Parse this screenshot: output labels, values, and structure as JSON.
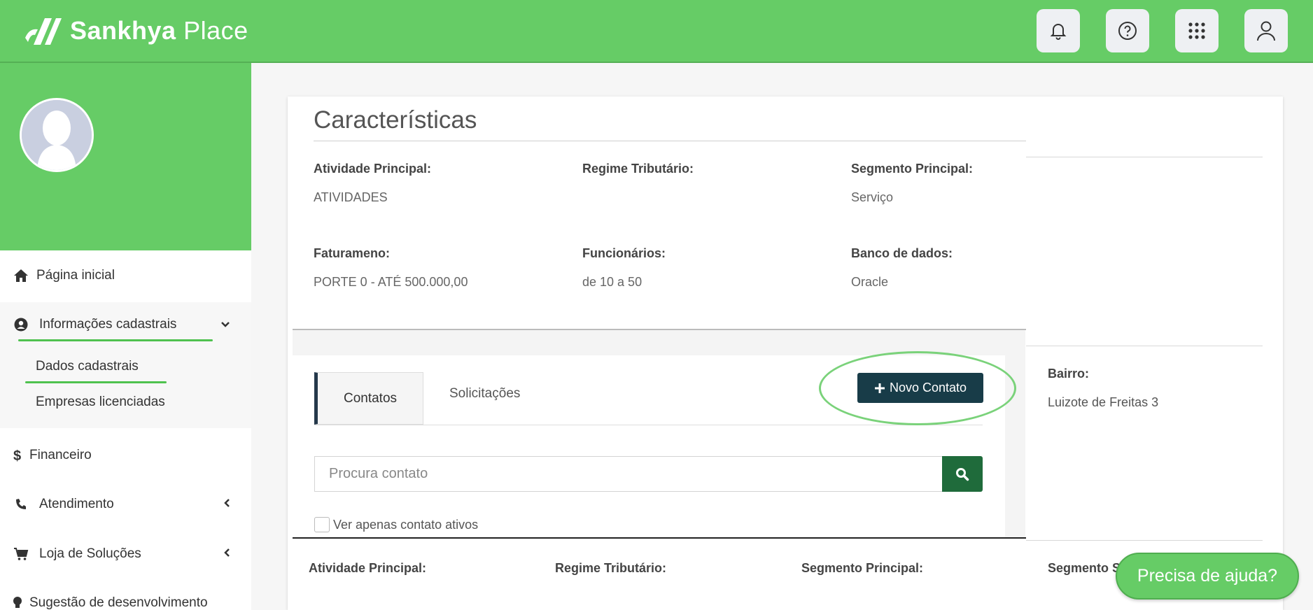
{
  "header": {
    "logo_bold": "Sankhya",
    "logo_light": "Place",
    "buttons": [
      "bell-icon",
      "help-circle-icon",
      "apps-grid-icon",
      "user-icon"
    ]
  },
  "sidebar": {
    "items": [
      {
        "label": "Página inicial",
        "icon": "home-icon"
      },
      {
        "label": "Informações cadastrais",
        "icon": "user-circle-icon"
      },
      {
        "label": "Financeiro",
        "icon": "dollar-icon"
      },
      {
        "label": "Atendimento",
        "icon": "phone-icon"
      },
      {
        "label": "Loja de Soluções",
        "icon": "cart-icon"
      },
      {
        "label": "Sugestão de desenvolvimento",
        "icon": "lightbulb-icon"
      }
    ],
    "subitems": [
      "Dados cadastrais",
      "Empresas licenciadas"
    ]
  },
  "characteristics": {
    "title": "Características",
    "fields": [
      {
        "label": "Atividade Principal:",
        "value": "ATIVIDADES"
      },
      {
        "label": "Regime Tributário:",
        "value": ""
      },
      {
        "label": "Segmento Principal:",
        "value": "Serviço"
      },
      {
        "label": "Faturameno:",
        "value": "PORTE 0 - ATÉ 500.000,00"
      },
      {
        "label": "Funcionários:",
        "value": "de 10 a 50"
      },
      {
        "label": "Banco de dados:",
        "value": "Oracle"
      }
    ]
  },
  "address": {
    "label": "Bairro:",
    "value": "Luizote de Freitas 3"
  },
  "contacts": {
    "tabs": [
      "Contatos",
      "Solicitações"
    ],
    "new_button": "Novo Contato",
    "search_placeholder": "Procura contato",
    "checkbox_label": "Ver apenas contato ativos"
  },
  "bottom_labels": [
    "Atividade Principal:",
    "Regime Tributário:",
    "Segmento Principal:",
    "Segmento S"
  ],
  "help_button": "Precisa de ajuda?"
}
